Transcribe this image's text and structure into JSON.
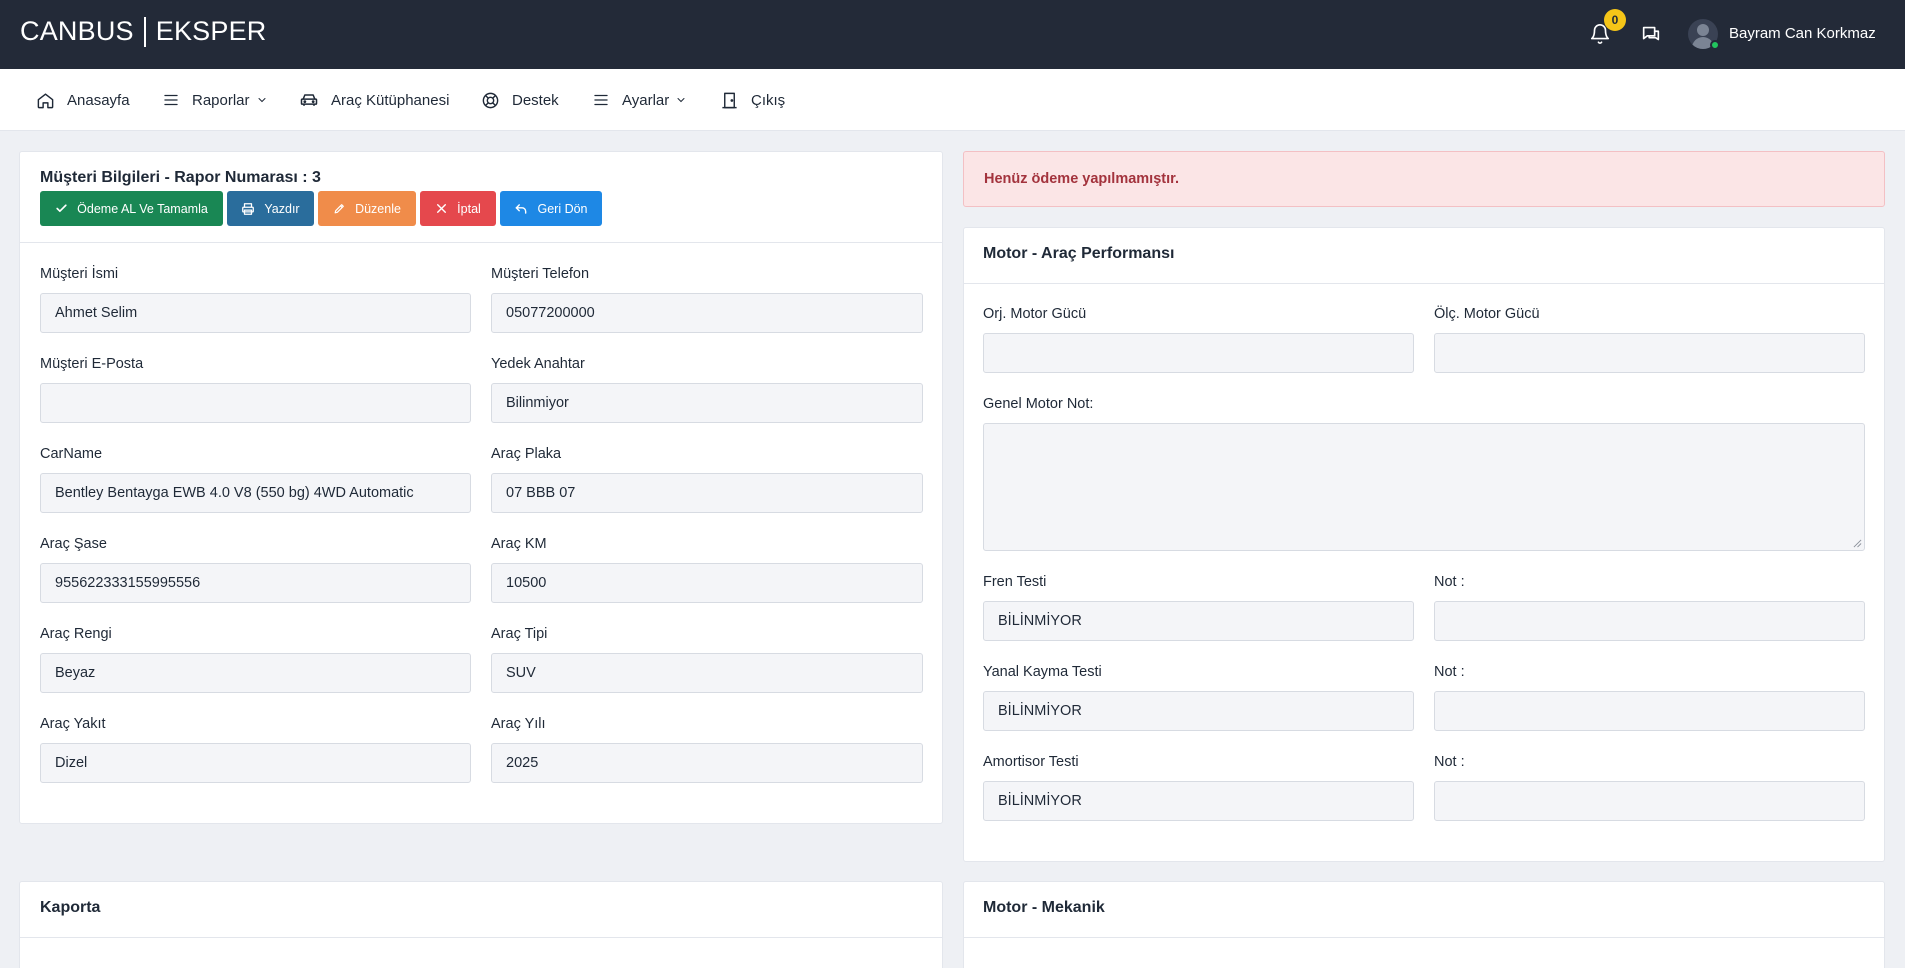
{
  "header": {
    "brand_left": "CANBUS",
    "brand_right": "EKSPER",
    "notification_count": "0",
    "user_name": "Bayram Can Korkmaz"
  },
  "nav": [
    {
      "label": "Anasayfa",
      "icon": "home-icon"
    },
    {
      "label": "Raporlar",
      "icon": "menu-icon",
      "dropdown": true
    },
    {
      "label": "Araç Kütüphanesi",
      "icon": "car-icon"
    },
    {
      "label": "Destek",
      "icon": "support-icon"
    },
    {
      "label": "Ayarlar",
      "icon": "menu-icon",
      "dropdown": true
    },
    {
      "label": "Çıkış",
      "icon": "logout-icon"
    }
  ],
  "customer_card": {
    "title": "Müşteri Bilgileri - Rapor Numarası : 3",
    "buttons": [
      {
        "label": "Ödeme AL Ve Tamamla",
        "color": "#198754",
        "icon": "check-icon"
      },
      {
        "label": "Yazdır",
        "color": "#2a6d9c",
        "icon": "printer-icon"
      },
      {
        "label": "Düzenle",
        "color": "#f08c4a",
        "icon": "pencil-icon"
      },
      {
        "label": "İptal",
        "color": "#e5484d",
        "icon": "close-icon"
      },
      {
        "label": "Geri Dön",
        "color": "#1e88e5",
        "icon": "undo-icon"
      }
    ],
    "fields": {
      "musteri_ismi": {
        "label": "Müşteri İsmi",
        "value": "Ahmet Selim"
      },
      "musteri_telefon": {
        "label": "Müşteri Telefon",
        "value": "05077200000"
      },
      "musteri_eposta": {
        "label": "Müşteri E-Posta",
        "value": ""
      },
      "yedek_anahtar": {
        "label": "Yedek Anahtar",
        "value": "Bilinmiyor"
      },
      "car_name": {
        "label": "CarName",
        "value": "Bentley Bentayga EWB 4.0 V8 (550 bg) 4WD Automatic"
      },
      "arac_plaka": {
        "label": "Araç Plaka",
        "value": "07 BBB 07"
      },
      "arac_sase": {
        "label": "Araç Şase",
        "value": "955622333155995556"
      },
      "arac_km": {
        "label": "Araç KM",
        "value": "10500"
      },
      "arac_rengi": {
        "label": "Araç Rengi",
        "value": "Beyaz"
      },
      "arac_tipi": {
        "label": "Araç Tipi",
        "value": "SUV"
      },
      "arac_yakit": {
        "label": "Araç Yakıt",
        "value": "Dizel"
      },
      "arac_yili": {
        "label": "Araç Yılı",
        "value": "2025"
      }
    }
  },
  "alert": {
    "text": "Henüz ödeme yapılmamıştır."
  },
  "performance_card": {
    "title": "Motor - Araç Performansı",
    "orj_motor_gucu": {
      "label": "Orj. Motor Gücü",
      "value": ""
    },
    "olc_motor_gucu": {
      "label": "Ölç. Motor Gücü",
      "value": ""
    },
    "genel_motor_not": {
      "label": "Genel Motor Not:",
      "value": ""
    },
    "fren_testi": {
      "label": "Fren Testi",
      "value": "BİLİNMİYOR",
      "note_label": "Not :",
      "note": ""
    },
    "yanal_kayma_testi": {
      "label": "Yanal Kayma Testi",
      "value": "BİLİNMİYOR",
      "note_label": "Not :",
      "note": ""
    },
    "amortisor_testi": {
      "label": "Amortisor Testi",
      "value": "BİLİNMİYOR",
      "note_label": "Not :",
      "note": ""
    }
  },
  "kaporta_card": {
    "title": "Kaporta"
  },
  "mekanik_card": {
    "title": "Motor - Mekanik"
  }
}
